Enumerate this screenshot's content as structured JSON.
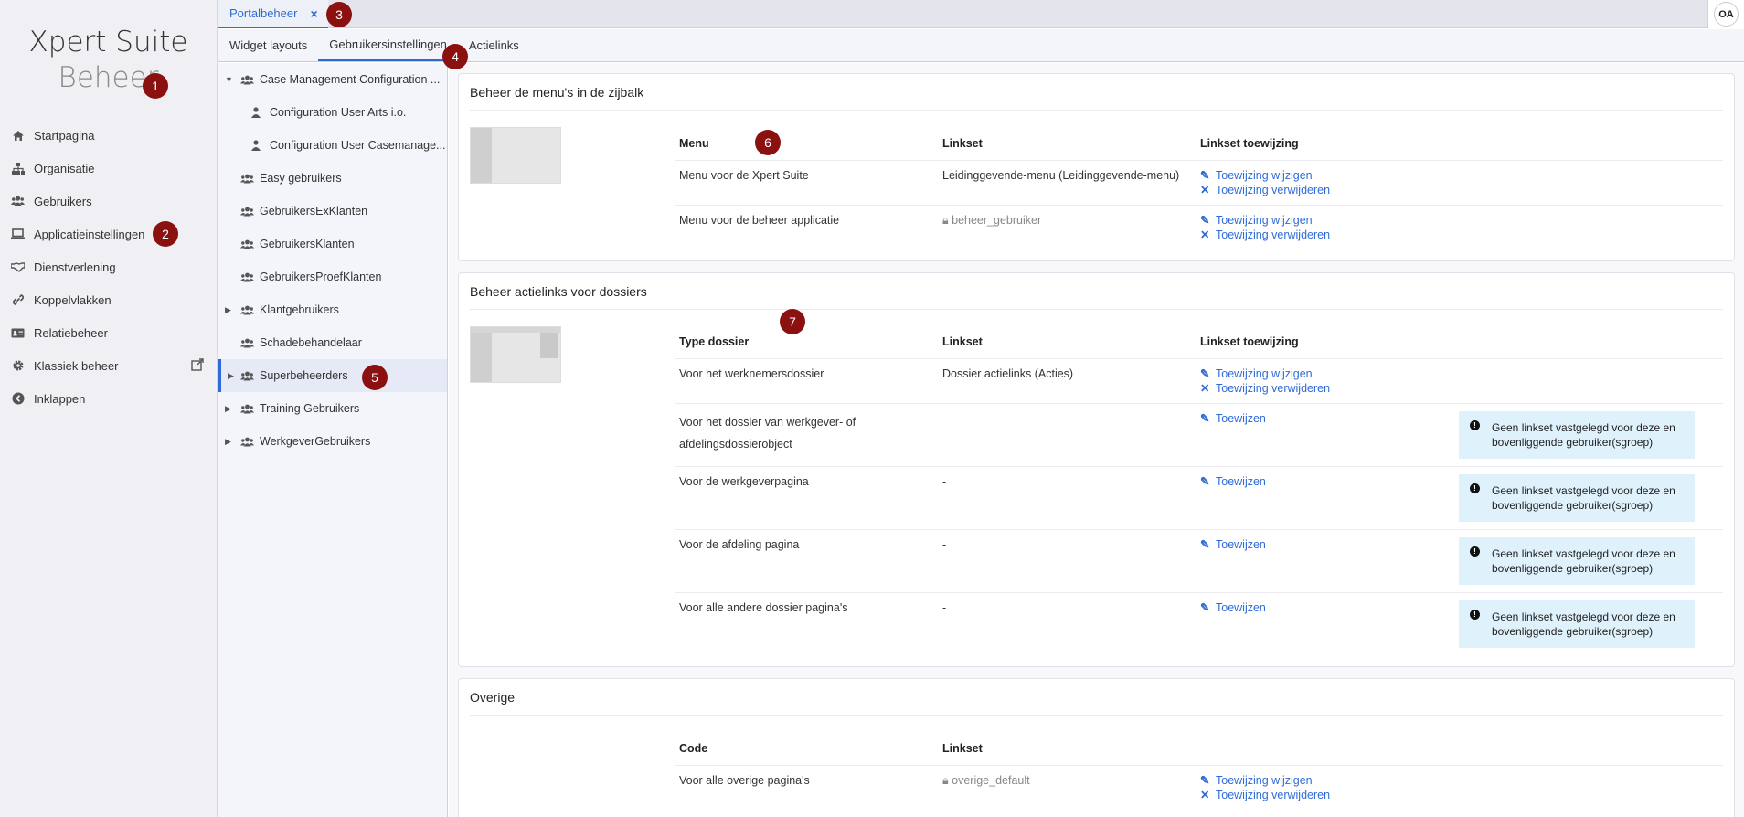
{
  "brand": {
    "line1": "Xpert Suite",
    "line2": "Beheer"
  },
  "nav": [
    {
      "label": "Startpagina",
      "icon": "home-icon"
    },
    {
      "label": "Organisatie",
      "icon": "sitemap-icon"
    },
    {
      "label": "Gebruikers",
      "icon": "users-icon"
    },
    {
      "label": "Applicatieinstellingen",
      "icon": "laptop-icon"
    },
    {
      "label": "Dienstverlening",
      "icon": "handshake-icon"
    },
    {
      "label": "Koppelvlakken",
      "icon": "link-icon"
    },
    {
      "label": "Relatiebeheer",
      "icon": "id-card-icon"
    },
    {
      "label": "Klassiek beheer",
      "icon": "gear-icon"
    },
    {
      "label": "Inklappen",
      "icon": "chevron-left-icon"
    }
  ],
  "top_tab": {
    "label": "Portalbeheer",
    "close": "×"
  },
  "avatar": "OA",
  "sub_tabs": [
    "Widget layouts",
    "Gebruikersinstellingen",
    "Actielinks"
  ],
  "tree": [
    {
      "label": "Case Management Configuration ...",
      "caret": "▼"
    },
    {
      "label": "Configuration User Arts i.o."
    },
    {
      "label": "Configuration User Casemanage..."
    },
    {
      "label": "Easy gebruikers"
    },
    {
      "label": "GebruikersExKlanten"
    },
    {
      "label": "GebruikersKlanten"
    },
    {
      "label": "GebruikersProefKlanten"
    },
    {
      "label": "Klantgebruikers",
      "caret": "▶"
    },
    {
      "label": "Schadebehandelaar"
    },
    {
      "label": "Superbeheerders",
      "caret": "▶"
    },
    {
      "label": "Training Gebruikers",
      "caret": "▶"
    },
    {
      "label": "WerkgeverGebruikers",
      "caret": "▶"
    }
  ],
  "cards": {
    "menus": {
      "title": "Beheer de menu's in de zijbalk",
      "headers": [
        "Menu",
        "Linkset",
        "Linkset toewijzing"
      ],
      "rows": [
        {
          "name": "Menu voor de Xpert Suite",
          "linkset": "Leidinggevende-menu (Leidinggevende-menu)",
          "links": [
            "Toewijzing wijzigen",
            "Toewijzing verwijderen"
          ]
        },
        {
          "name": "Menu voor de beheer applicatie",
          "linkset": "beheer_gebruiker",
          "links": [
            "Toewijzing wijzigen",
            "Toewijzing verwijderen"
          ]
        }
      ]
    },
    "actions": {
      "title": "Beheer actielinks voor dossiers",
      "headers": [
        "Type dossier",
        "Linkset",
        "Linkset toewijzing"
      ],
      "rows": [
        {
          "name": "Voor het werknemersdossier",
          "linkset": "Dossier actielinks (Acties)",
          "links": [
            "Toewijzing wijzigen",
            "Toewijzing verwijderen"
          ]
        },
        {
          "name": "Voor het dossier van werkgever- of afdelingsdossierobject",
          "linkset": "-",
          "link": "Toewijzen",
          "info": "Geen linkset vastgelegd voor deze en bovenliggende gebruiker(sgroep)"
        },
        {
          "name": "Voor de werkgeverpagina",
          "linkset": "-",
          "link": "Toewijzen",
          "info": "Geen linkset vastgelegd voor deze en bovenliggende gebruiker(sgroep)"
        },
        {
          "name": "Voor de afdeling pagina",
          "linkset": "-",
          "link": "Toewijzen",
          "info": "Geen linkset vastgelegd voor deze en bovenliggende gebruiker(sgroep)"
        },
        {
          "name": "Voor alle andere dossier pagina's",
          "linkset": "-",
          "link": "Toewijzen",
          "info": "Geen linkset vastgelegd voor deze en bovenliggende gebruiker(sgroep)"
        }
      ]
    },
    "other": {
      "title": "Overige",
      "headers": [
        "Code",
        "Linkset"
      ],
      "rows": [
        {
          "name": "Voor alle overige pagina's",
          "linkset": "overige_default",
          "links": [
            "Toewijzing wijzigen",
            "Toewijzing verwijderen"
          ]
        }
      ]
    }
  },
  "badges": [
    "1",
    "2",
    "3",
    "4",
    "5",
    "6",
    "7"
  ],
  "colors": {
    "accent": "#2f6bd6",
    "badge": "#8b1010",
    "info_bg": "#dff1fb"
  }
}
